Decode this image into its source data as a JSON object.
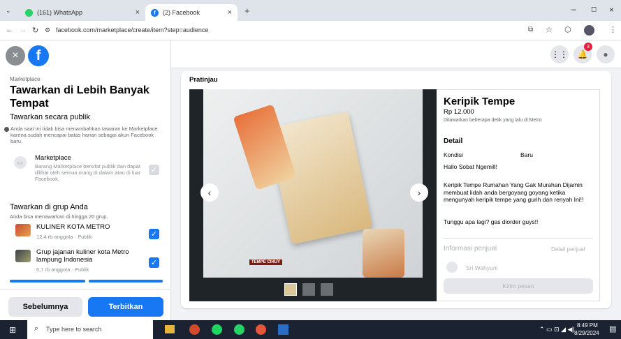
{
  "tabs": [
    {
      "label": "(161) WhatsApp",
      "icon": "whatsapp-icon"
    },
    {
      "label": "(2) Facebook",
      "icon": "facebook-icon"
    }
  ],
  "address": "facebook.com/marketplace/create/item?step=audience",
  "sidebar": {
    "breadcrumb": "Marketplace",
    "title": "Tawarkan di Lebih Banyak Tempat",
    "public_heading": "Tawarkan secara publik",
    "public_warning": "Anda saat ini tidak bisa menambahkan tawaran ke Marketplace karena sudah mencapai batas harian sebagai akun Facebook baru.",
    "marketplace_option": {
      "title": "Marketplace",
      "desc": "Barang Marketplace bersifat publik dan dapat dilihat oleh semua orang di dalam atau di luar Facebook."
    },
    "groups_heading": "Tawarkan di grup Anda",
    "groups_sub": "Anda bisa menawarkan di hingga 20 grup.",
    "groups": [
      {
        "name": "KULINER KOTA METRO",
        "meta": "12,4 rb anggota · Publik"
      },
      {
        "name": "Grup jajanan kuliner kota Metro lampung Indonesia",
        "meta": "5,7 rb anggota · Publik"
      }
    ],
    "back_button": "Sebelumnya",
    "publish_button": "Terbitkan"
  },
  "preview": {
    "label": "Pratinjau",
    "item_title": "Keripik Tempe",
    "price": "Rp 12.000",
    "posted": "Ditawarkan beberapa detik yang lalu di Metro",
    "detail_heading": "Detail",
    "condition_label": "Kondisi",
    "condition_value": "Baru",
    "desc1": "Hallo Sobat Ngemill!",
    "desc2": "Keripik Tempe Rumahan Yang Gak Murahan Dijamin membuat lidah anda bergoyang goyang ketika mengunyah keripik tempe yang gurih dan renyah Ini!!",
    "desc3": "Tunggu apa lagi? gas diorder guys!!",
    "seller_heading": "Informasi penjual",
    "seller_link": "Detail penjual",
    "seller_name": "Sri Wahyuni",
    "send_button": "Kirim pesan",
    "brand_text": "TEMPE CIHUY"
  },
  "notifications_count": "3",
  "taskbar": {
    "search_placeholder": "Type here to search",
    "time": "8:49 PM",
    "date": "8/29/2024"
  },
  "colors": {
    "accent": "#1877f2",
    "taskbar": "#1b2333"
  }
}
